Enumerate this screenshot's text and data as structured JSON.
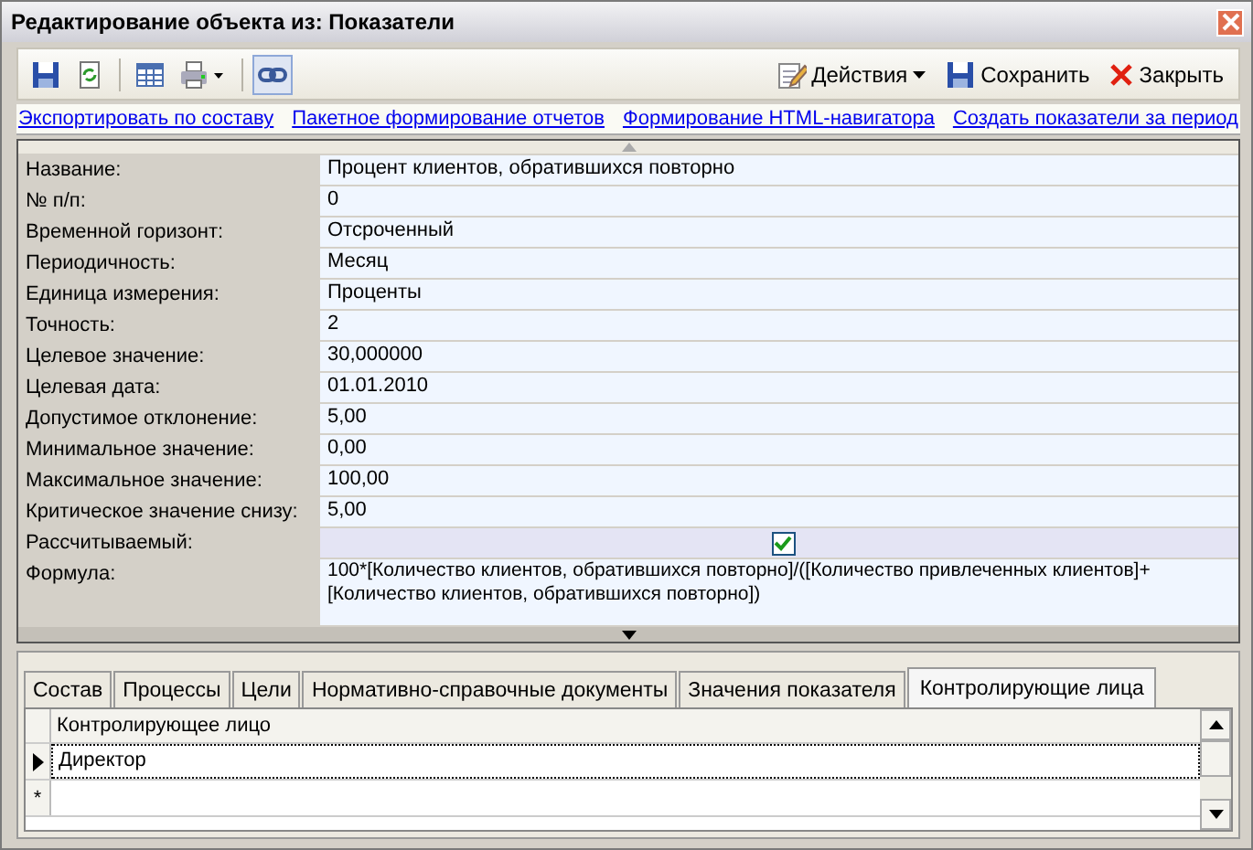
{
  "window": {
    "title": "Редактирование объекта из: Показатели"
  },
  "toolbar": {
    "link_pressed": true,
    "actions": [
      {
        "kind": "menu",
        "label": "Действия"
      },
      {
        "kind": "save",
        "label": "Сохранить"
      },
      {
        "kind": "close",
        "label": "Закрыть"
      }
    ]
  },
  "links": [
    "Экспортировать по составу",
    "Пакетное формирование отчетов",
    "Формирование HTML-навигатора",
    "Создать показатели за период"
  ],
  "properties": [
    {
      "kind": "text",
      "label": "Название:",
      "value": "Процент клиентов, обратившихся повторно"
    },
    {
      "kind": "text",
      "label": "№ п/п:",
      "value": "0"
    },
    {
      "kind": "text",
      "label": "Временной горизонт:",
      "value": "Отсроченный"
    },
    {
      "kind": "text",
      "label": "Периодичность:",
      "value": "Месяц"
    },
    {
      "kind": "text",
      "label": "Единица измерения:",
      "value": "Проценты"
    },
    {
      "kind": "text",
      "label": "Точность:",
      "value": "2"
    },
    {
      "kind": "text",
      "label": "Целевое значение:",
      "value": "30,000000"
    },
    {
      "kind": "text",
      "label": "Целевая дата:",
      "value": "01.01.2010"
    },
    {
      "kind": "text",
      "label": "Допустимое отклонение:",
      "value": "5,00"
    },
    {
      "kind": "text",
      "label": "Минимальное значение:",
      "value": "0,00"
    },
    {
      "kind": "text",
      "label": "Максимальное значение:",
      "value": "100,00"
    },
    {
      "kind": "text",
      "label": "Критическое значение снизу:",
      "value": "5,00"
    },
    {
      "kind": "check",
      "label": "Рассчитываемый:",
      "checked": true
    },
    {
      "kind": "multiline",
      "label": "Формула:",
      "value": "100*[Количество клиентов, обратившихся повторно]/([Количество привлеченных клиентов]+ [Количество клиентов, обратившихся повторно])"
    }
  ],
  "tabs": [
    {
      "label": "Состав",
      "selected": false
    },
    {
      "label": "Процессы",
      "selected": false
    },
    {
      "label": "Цели",
      "selected": false
    },
    {
      "label": "Нормативно-справочные документы",
      "selected": false
    },
    {
      "label": "Значения показателя",
      "selected": false
    },
    {
      "label": "Контролирующие лица",
      "selected": true
    }
  ],
  "grid": {
    "columns": [
      "Контролирующее лицо"
    ],
    "rows": [
      {
        "cells": [
          "Директор"
        ],
        "current": true
      }
    ],
    "new_row_marker": "*"
  }
}
